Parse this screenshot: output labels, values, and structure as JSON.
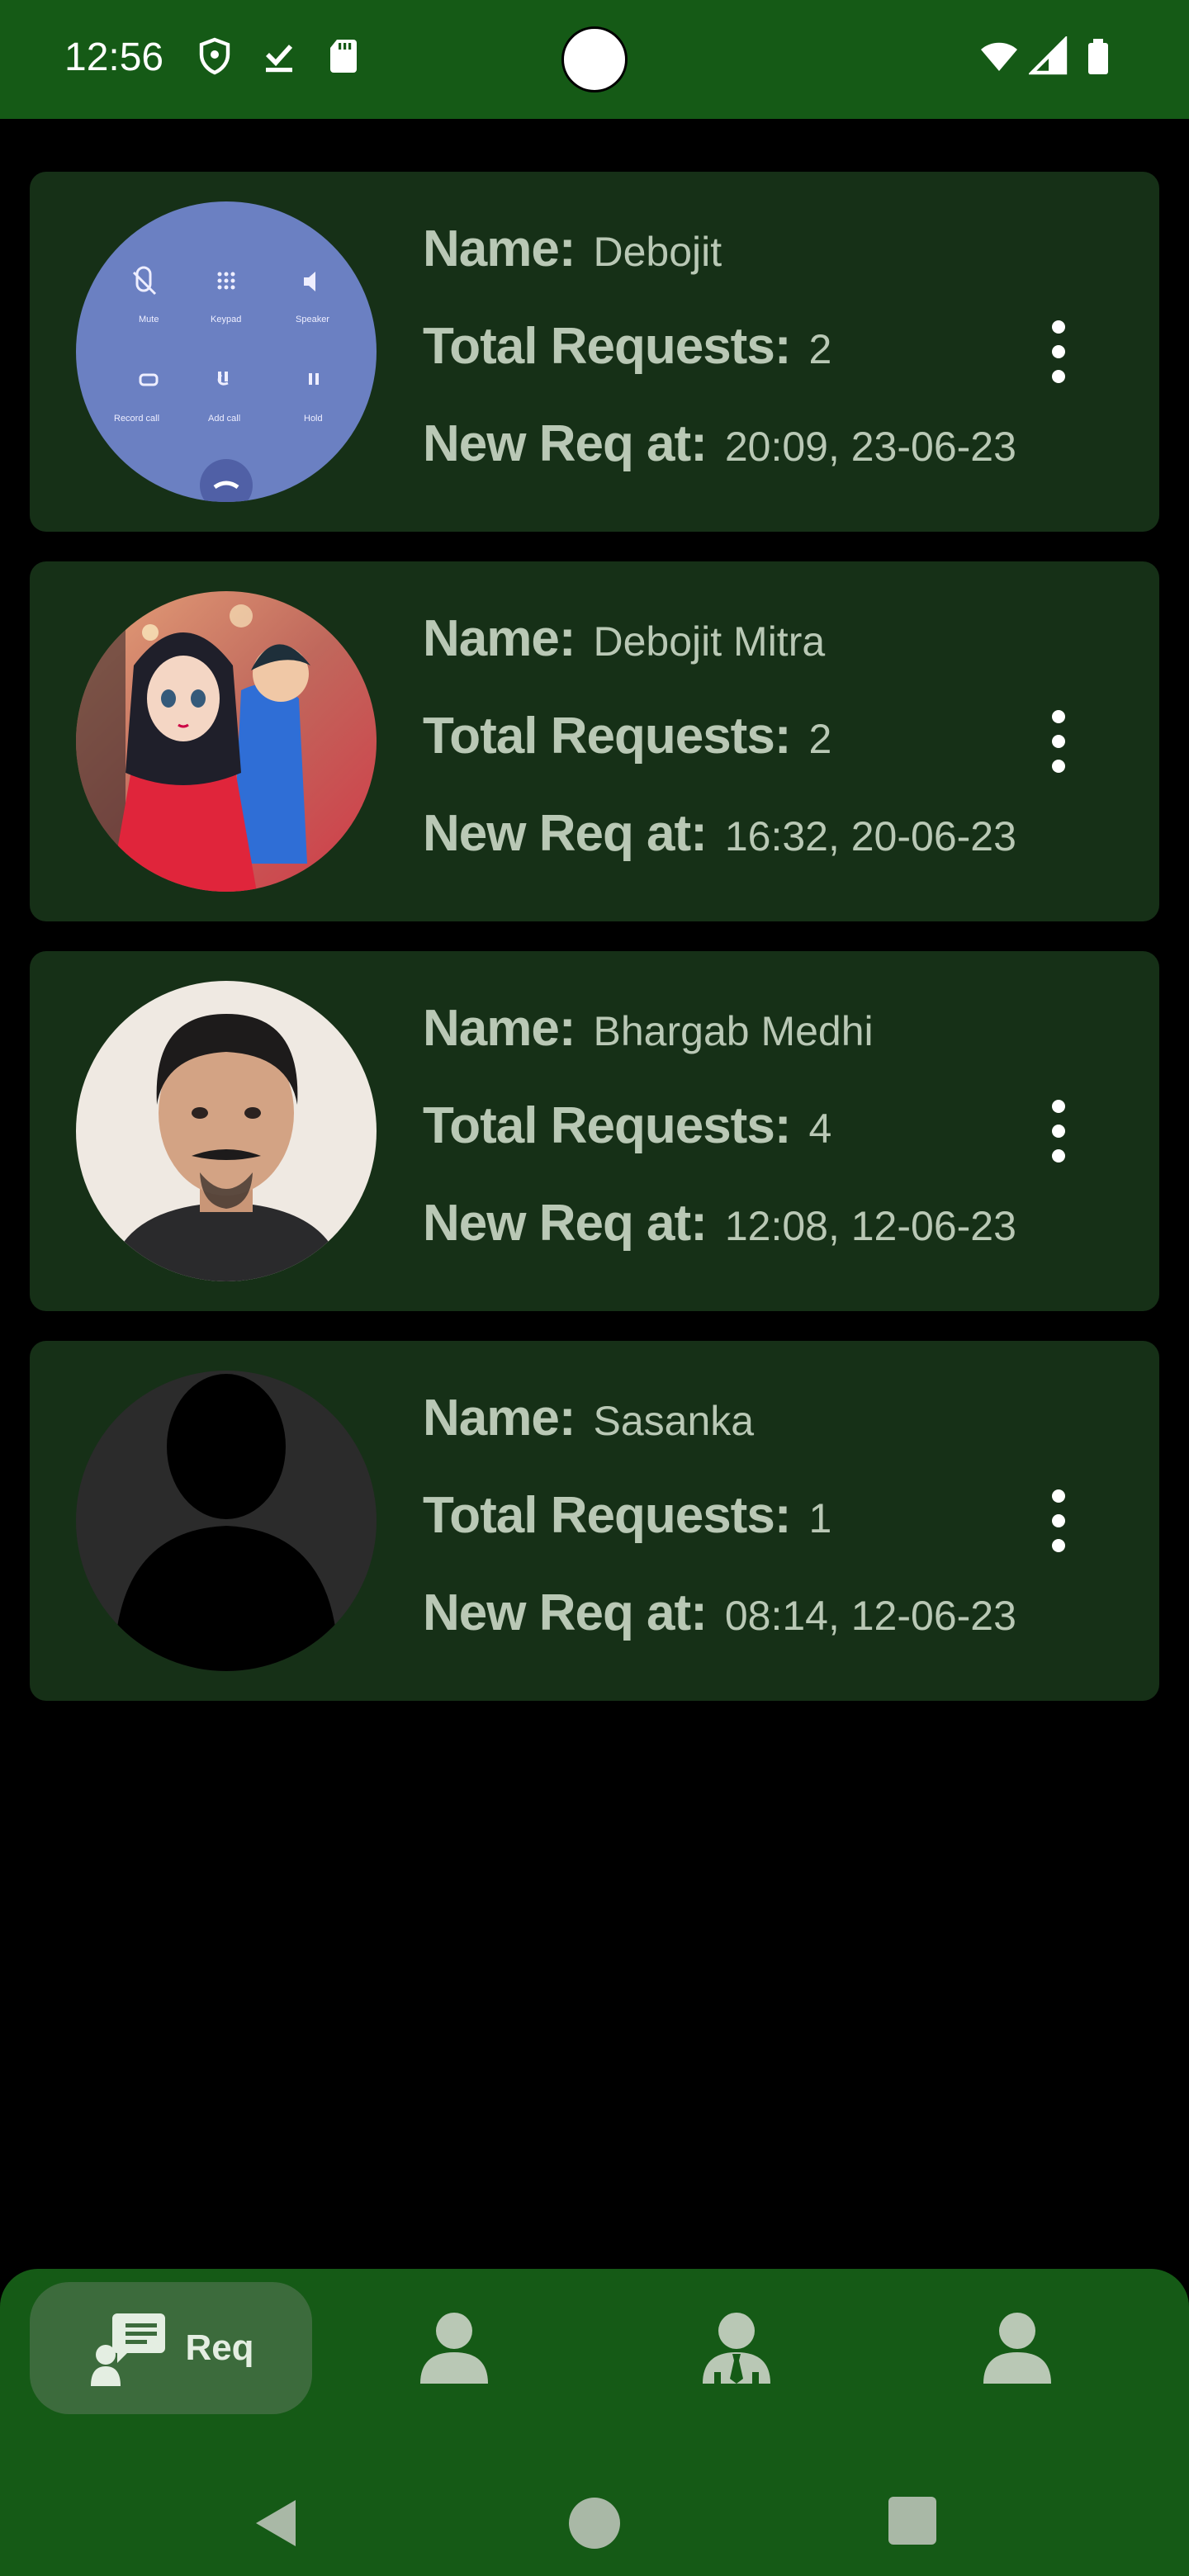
{
  "status_bar": {
    "time": "12:56",
    "icons": [
      "shield-icon",
      "download-done-icon",
      "sd-card-icon",
      "wifi-icon",
      "signal-icon",
      "battery-icon"
    ]
  },
  "requests": [
    {
      "name_label": "Name:",
      "name": "Debojit",
      "total_label": "Total Requests:",
      "total": "2",
      "new_label": "New Req at:",
      "new_at": "20:09, 23-06-23",
      "avatar": "call-screen-avatar",
      "avatar_text": [
        "Mute",
        "Keypad",
        "Speaker",
        "Record call",
        "Add call",
        "Hold"
      ]
    },
    {
      "name_label": "Name:",
      "name": "Debojit Mitra",
      "total_label": "Total Requests:",
      "total": "2",
      "new_label": "New Req at:",
      "new_at": "16:32, 20-06-23",
      "avatar": "anime-couple-avatar"
    },
    {
      "name_label": "Name:",
      "name": "Bhargab Medhi",
      "total_label": "Total Requests:",
      "total": "4",
      "new_label": "New Req at:",
      "new_at": "12:08, 12-06-23",
      "avatar": "man-photo-avatar"
    },
    {
      "name_label": "Name:",
      "name": "Sasanka",
      "total_label": "Total Requests:",
      "total": "1",
      "new_label": "New Req at:",
      "new_at": "08:14, 12-06-23",
      "avatar": "default-person-avatar"
    }
  ],
  "bottom_nav": {
    "items": [
      {
        "label": "Req",
        "icon": "request-chat-icon",
        "active": true
      },
      {
        "label": "",
        "icon": "person-icon",
        "active": false
      },
      {
        "label": "",
        "icon": "person-tie-icon",
        "active": false
      },
      {
        "label": "",
        "icon": "person-icon",
        "active": false
      }
    ]
  },
  "system_nav": {
    "icons": [
      "back-icon",
      "home-icon",
      "recents-icon"
    ]
  },
  "colors": {
    "bar": "#155a16",
    "card": "#163017",
    "text": "#b9c8b5",
    "active_pill": "#3c6b3c"
  }
}
